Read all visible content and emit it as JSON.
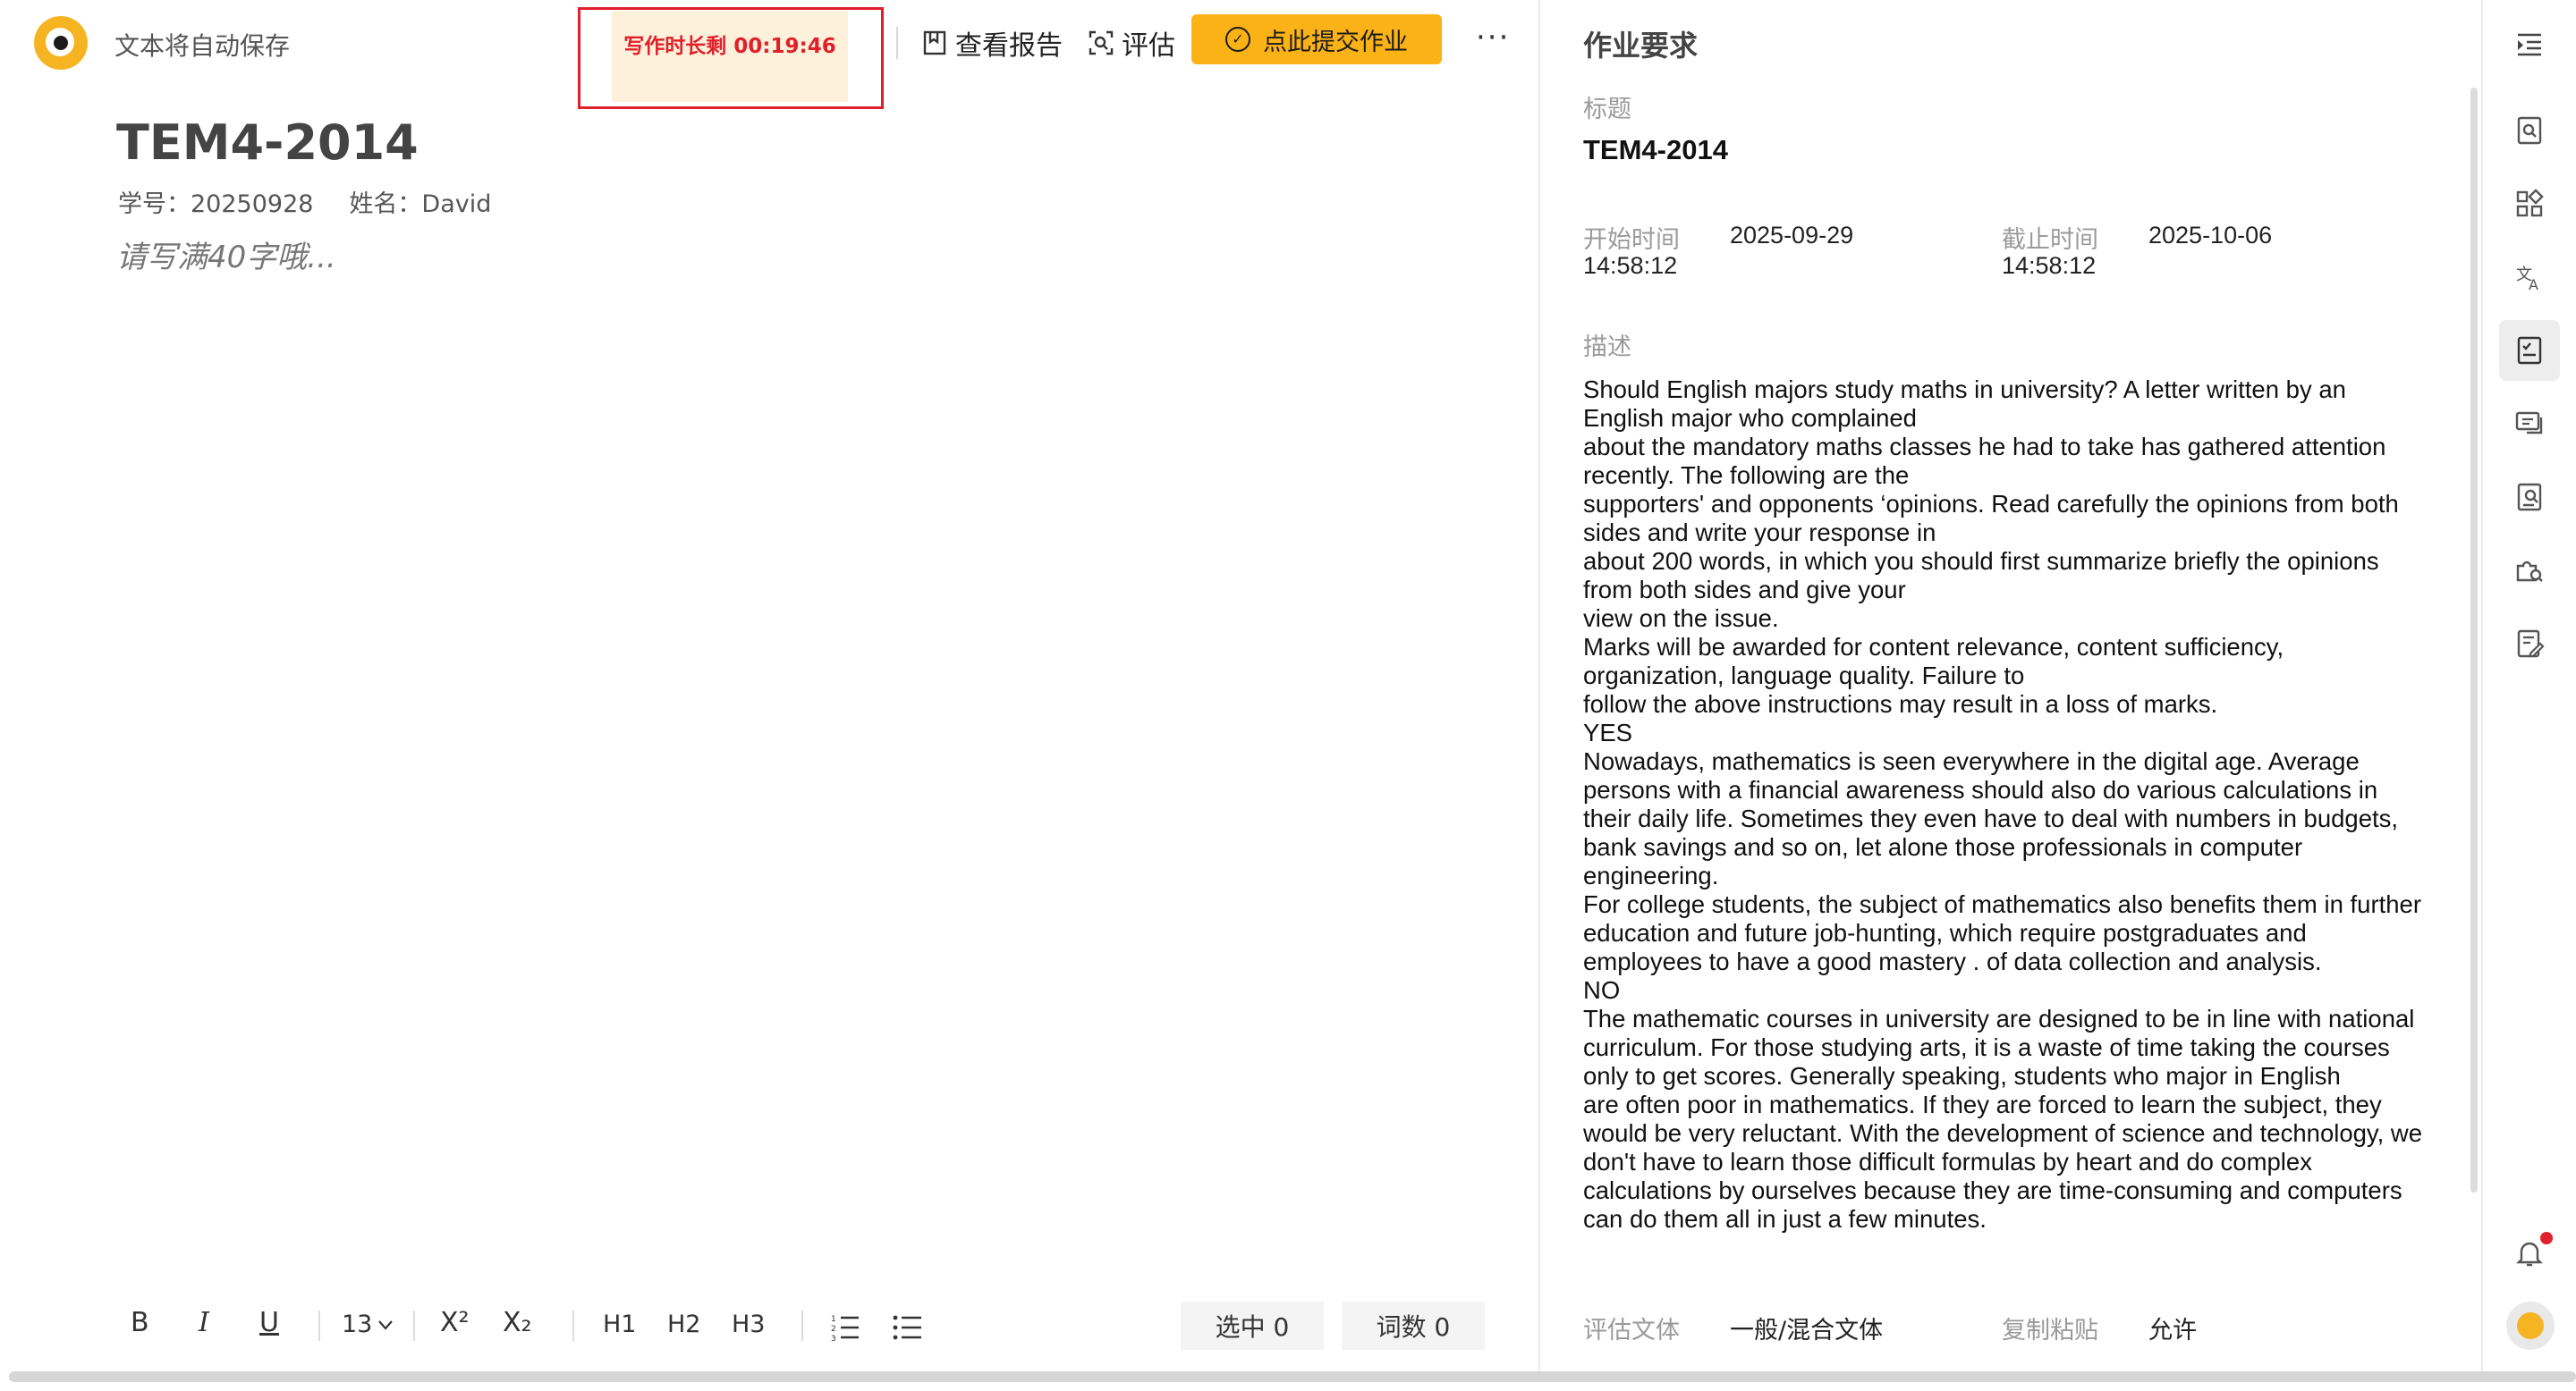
{
  "header": {
    "autosave_text": "文本将自动保存",
    "timer_label": "写作时长剩 00:19:46",
    "report_label": "查看报告",
    "evaluate_label": "评估",
    "submit_label": "点此提交作业",
    "more_label": "···"
  },
  "document": {
    "title": "TEM4-2014",
    "student_id": "学号：20250928",
    "student_name": "姓名：David",
    "placeholder": "请写满40字哦..."
  },
  "toolbar": {
    "bold": "B",
    "italic": "I",
    "underline": "U",
    "font_size": "13",
    "superscript": "X²",
    "subscript": "X₂",
    "h1": "H1",
    "h2": "H2",
    "h3": "H3",
    "selected": "选中 0",
    "word_count": "词数 0"
  },
  "requirements": {
    "heading": "作业要求",
    "title_label": "标题",
    "title": "TEM4-2014",
    "start_label": "开始时间",
    "start_date": "2025-09-29",
    "start_time": "14:58:12",
    "deadline_label": "截止时间",
    "deadline_date": "2025-10-06",
    "deadline_time": "14:58:12",
    "description_label": "描述",
    "description": "Should English majors study maths in university? A letter written by an English major who complained\nabout the mandatory maths classes he had to take has gathered attention recently. The following are the\nsupporters' and opponents ‘opinions. Read carefully the opinions from both sides and write your response in\nabout 200 words, in which you should first summarize briefly the opinions from both sides and give your\nview on the issue.\nMarks will be awarded for content relevance, content sufficiency, organization, language quality. Failure to\nfollow the above instructions may result in a loss of marks.\nYES\nNowadays, mathematics is seen everywhere in the digital age. Average persons with a financial awareness should also do various calculations in their daily life. Sometimes they even have to deal with numbers in budgets, bank savings and so on, let alone those professionals in computer engineering.\nFor college students, the subject of mathematics also benefits them in further education and future job-hunting, which require postgraduates and employees to have a good mastery . of data collection and analysis.\nNO\nThe mathematic courses in university are designed to be in line with national curriculum. For those studying arts, it is a waste of time taking the courses only to get scores. Generally speaking, students who major in English\nare often poor in mathematics. If they are forced to learn the subject, they would be very reluctant. With the development of science and technology, we don't have to learn those difficult formulas by heart and do complex calculations by ourselves because they are time-consuming and computers can do them all in just a few minutes.",
    "genre_label": "评估文体",
    "genre_value": "一般/混合文体",
    "paste_label": "复制粘贴",
    "paste_value": "允许"
  },
  "icons": {
    "rail": [
      "outline-toggle-icon",
      "search-doc-icon",
      "apps-icon",
      "translate-icon",
      "assignment-icon",
      "comments-icon",
      "review-icon",
      "plugin-search-icon",
      "edit-checklist-icon",
      "bell-icon",
      "avatar"
    ]
  },
  "colors": {
    "accent": "#fbb216",
    "timer_red": "#e0202a",
    "timer_bg": "#fdf1dc"
  }
}
